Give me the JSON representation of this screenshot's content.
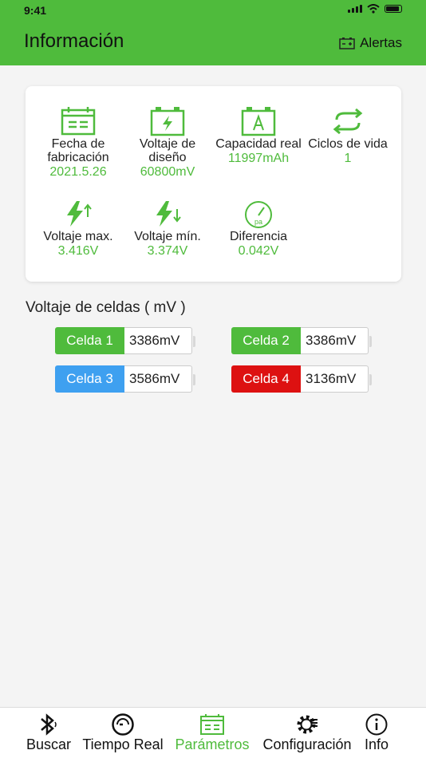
{
  "status_bar": {
    "time": "9:41"
  },
  "header": {
    "title": "Información",
    "alerts_label": "Alertas"
  },
  "info": [
    {
      "label": "Fecha de fabricación",
      "value": "2021.5.26",
      "icon": "calendar-icon"
    },
    {
      "label": "Voltaje de diseño",
      "value": "60800mV",
      "icon": "battery-bolt-icon"
    },
    {
      "label": "Capacidad real",
      "value": "11997mAh",
      "icon": "battery-a-icon"
    },
    {
      "label": "Ciclos de vida",
      "value": "1",
      "icon": "cycle-icon"
    },
    {
      "label": "Voltaje max.",
      "value": "3.416V",
      "icon": "bolt-up-icon"
    },
    {
      "label": "Voltaje mín.",
      "value": "3.374V",
      "icon": "bolt-down-icon"
    },
    {
      "label": "Diferencia",
      "value": "0.042V",
      "icon": "gauge-icon"
    }
  ],
  "cells_title": "Voltaje de celdas ( mV )",
  "cells": [
    {
      "label": "Celda 1",
      "value": "3386mV",
      "color": "#4fbb3c"
    },
    {
      "label": "Celda 2",
      "value": "3386mV",
      "color": "#4fbb3c"
    },
    {
      "label": "Celda 3",
      "value": "3586mV",
      "color": "#3ea0f0"
    },
    {
      "label": "Celda 4",
      "value": "3136mV",
      "color": "#dd1111"
    }
  ],
  "tabs": [
    {
      "label": "Buscar",
      "icon": "bluetooth-icon"
    },
    {
      "label": "Tiempo Real",
      "icon": "speedometer-icon"
    },
    {
      "label": "Parámetros",
      "icon": "parameters-icon",
      "active": true
    },
    {
      "label": "Configuración",
      "icon": "settings-gear-icon"
    },
    {
      "label": "Info",
      "icon": "info-icon"
    }
  ],
  "colors": {
    "accent": "#4fbb3c",
    "background": "#f4f4f4"
  }
}
